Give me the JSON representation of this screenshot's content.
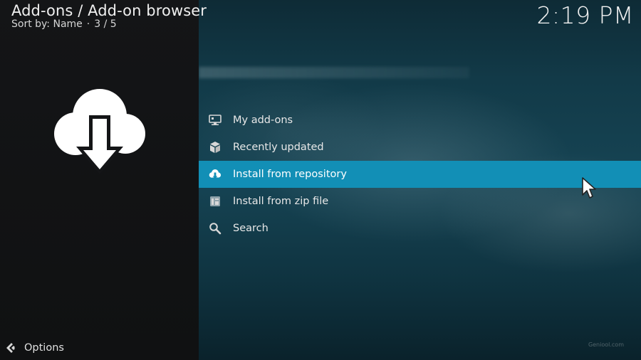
{
  "header": {
    "title": "Add-ons / Add-on browser",
    "sort_label": "Sort by: Name",
    "separator": "·",
    "position": "3 / 5"
  },
  "clock": "2:19 PM",
  "menu": {
    "items": [
      {
        "label": "My add-ons",
        "icon": "monitor-icon",
        "focused": false
      },
      {
        "label": "Recently updated",
        "icon": "box-icon",
        "focused": false
      },
      {
        "label": "Install from repository",
        "icon": "cloud-download-icon",
        "focused": true
      },
      {
        "label": "Install from zip file",
        "icon": "zip-file-icon",
        "focused": false
      },
      {
        "label": "Search",
        "icon": "search-icon",
        "focused": false
      }
    ]
  },
  "footer": {
    "options_label": "Options"
  },
  "watermark": "Geniool.com",
  "colors": {
    "focus": "#128fb6",
    "text": "#e8e8e8",
    "panel": "#141517"
  }
}
